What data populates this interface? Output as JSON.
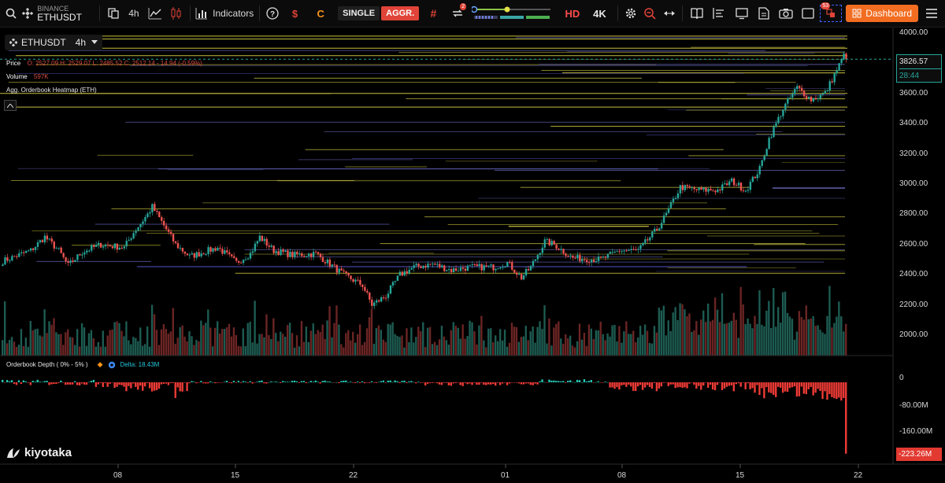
{
  "toolbar": {
    "exchange": "BINANCE",
    "symbol": "ETHUSDT",
    "interval": "4h",
    "indicators_label": "Indicators",
    "dollar_label": "$",
    "c_label": "C",
    "single_label": "SINGLE",
    "aggr_label": "AGGR.",
    "hash_label": "#",
    "refresh_badge": "2",
    "hd_label": "HD",
    "k4_label": "4K",
    "notif_count": "53",
    "dashboard_label": "Dashboard",
    "colors": {
      "accent": "#f7931a",
      "dashboard": "#f26d21",
      "aggr": "#e04438",
      "hd": "#ff4d4d"
    }
  },
  "legend": {
    "symbol_tag": "ETHUSDT",
    "interval": "4h",
    "price_label": "Price",
    "ohlc": "O: 2527.09  H: 2529.07  L: 2485.52  C: 2512.14 - 14.94 (-0.59%)",
    "volume_label": "Volume",
    "volume_value": "597K",
    "heatmap_label": "Agg. Orderbook Heatmap (ETH)"
  },
  "price_axis": {
    "ticks": [
      "4000.00",
      "3800.00",
      "3600.00",
      "3400.00",
      "3200.00",
      "3000.00",
      "2800.00",
      "2600.00",
      "2400.00",
      "2200.00",
      "2000.00"
    ],
    "last_price": "3826.57",
    "countdown": "28:44"
  },
  "depth_panel": {
    "title": "Orderbook Depth ( 0% - 5% )",
    "delta_label": "Delta: 18.43M",
    "ticks": [
      "0",
      "-80.00M",
      "-160.00M"
    ],
    "last_value": "-223.26M"
  },
  "time_axis": {
    "ticks": [
      "08",
      "15",
      "22",
      "01",
      "08",
      "15",
      "22"
    ]
  },
  "brand": {
    "name": "kiyotaka"
  },
  "chart_data": [
    {
      "type": "candlestick",
      "title": "ETHUSDT 4h",
      "ylim": [
        1960,
        4030
      ],
      "y_ticks": [
        2000,
        2200,
        2400,
        2600,
        2800,
        3000,
        3200,
        3400,
        3600,
        3800,
        4000
      ],
      "x_ticks": [
        "08",
        "15",
        "22",
        "01",
        "08",
        "15",
        "22"
      ],
      "close_anchors": [
        [
          0,
          2490
        ],
        [
          12,
          2560
        ],
        [
          18,
          2650
        ],
        [
          24,
          2560
        ],
        [
          28,
          2460
        ],
        [
          34,
          2550
        ],
        [
          42,
          2600
        ],
        [
          52,
          2580
        ],
        [
          56,
          2680
        ],
        [
          62,
          2800
        ],
        [
          64,
          2850
        ],
        [
          70,
          2700
        ],
        [
          74,
          2600
        ],
        [
          80,
          2520
        ],
        [
          86,
          2550
        ],
        [
          92,
          2580
        ],
        [
          100,
          2480
        ],
        [
          106,
          2540
        ],
        [
          110,
          2650
        ],
        [
          116,
          2560
        ],
        [
          124,
          2530
        ],
        [
          134,
          2540
        ],
        [
          146,
          2400
        ],
        [
          154,
          2330
        ],
        [
          158,
          2200
        ],
        [
          164,
          2260
        ],
        [
          170,
          2400
        ],
        [
          176,
          2450
        ],
        [
          184,
          2470
        ],
        [
          192,
          2430
        ],
        [
          200,
          2450
        ],
        [
          210,
          2450
        ],
        [
          216,
          2480
        ],
        [
          222,
          2380
        ],
        [
          226,
          2450
        ],
        [
          232,
          2620
        ],
        [
          236,
          2600
        ],
        [
          244,
          2510
        ],
        [
          256,
          2500
        ],
        [
          264,
          2560
        ],
        [
          272,
          2560
        ],
        [
          280,
          2700
        ],
        [
          284,
          2800
        ],
        [
          290,
          2980
        ],
        [
          298,
          2960
        ],
        [
          306,
          2960
        ],
        [
          312,
          3020
        ],
        [
          318,
          2960
        ],
        [
          324,
          3100
        ],
        [
          328,
          3300
        ],
        [
          334,
          3500
        ],
        [
          340,
          3640
        ],
        [
          346,
          3560
        ],
        [
          352,
          3600
        ],
        [
          360,
          3850
        ]
      ],
      "volume_range": [
        0,
        597000
      ],
      "last_close": 3826.57
    },
    {
      "type": "bar",
      "title": "Orderbook Depth ( 0% - 5% )",
      "ylim": [
        -225,
        10
      ],
      "y_ticks": [
        0,
        -80,
        -160
      ],
      "unit": "M",
      "last_value": -223.26,
      "delta": 18.43
    }
  ]
}
